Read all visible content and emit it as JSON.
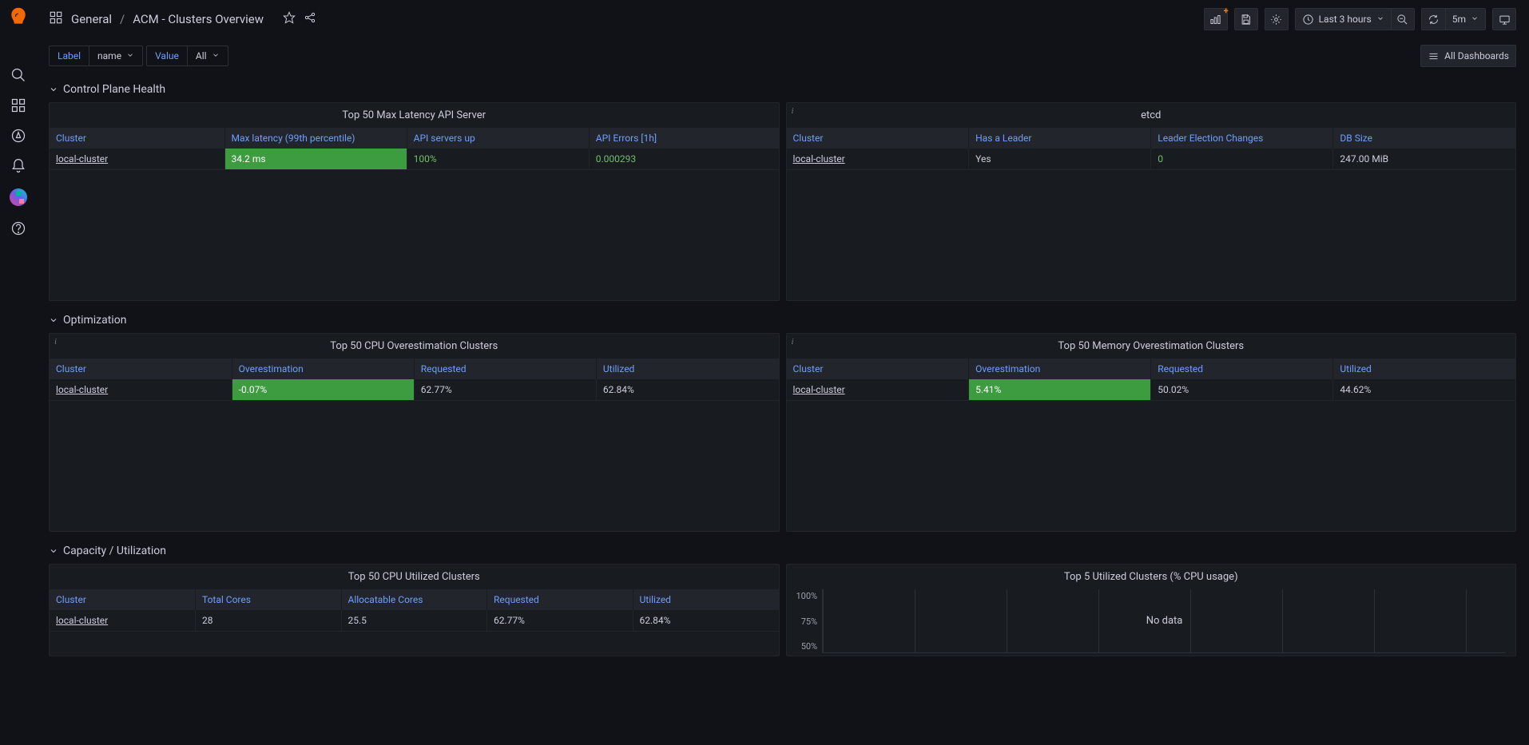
{
  "breadcrumb": {
    "folder": "General",
    "title": "ACM - Clusters Overview"
  },
  "toolbar": {
    "time_range": "Last 3 hours",
    "refresh_interval": "5m",
    "all_dashboards": "All Dashboards"
  },
  "variables": {
    "label_label": "Label",
    "label_value": "name",
    "value_label": "Value",
    "value_value": "All"
  },
  "sections": {
    "control_plane": "Control Plane Health",
    "optimization": "Optimization",
    "capacity": "Capacity / Utilization"
  },
  "panels": {
    "api_server": {
      "title": "Top 50 Max Latency API Server",
      "headers": [
        "Cluster",
        "Max latency (99th percentile)",
        "API servers up",
        "API Errors [1h]"
      ],
      "row": {
        "cluster": "local-cluster",
        "latency": "34.2 ms",
        "servers_up": "100%",
        "errors": "0.000293"
      }
    },
    "etcd": {
      "title": "etcd",
      "headers": [
        "Cluster",
        "Has a Leader",
        "Leader Election Changes",
        "DB Size"
      ],
      "row": {
        "cluster": "local-cluster",
        "leader": "Yes",
        "changes": "0",
        "db_size": "247.00 MiB"
      }
    },
    "cpu_over": {
      "title": "Top 50 CPU Overestimation Clusters",
      "headers": [
        "Cluster",
        "Overestimation",
        "Requested",
        "Utilized"
      ],
      "row": {
        "cluster": "local-cluster",
        "over": "-0.07%",
        "requested": "62.77%",
        "utilized": "62.84%"
      }
    },
    "mem_over": {
      "title": "Top 50 Memory Overestimation Clusters",
      "headers": [
        "Cluster",
        "Overestimation",
        "Requested",
        "Utilized"
      ],
      "row": {
        "cluster": "local-cluster",
        "over": "5.41%",
        "requested": "50.02%",
        "utilized": "44.62%"
      }
    },
    "cpu_util": {
      "title": "Top 50 CPU Utilized Clusters",
      "headers": [
        "Cluster",
        "Total Cores",
        "Allocatable Cores",
        "Requested",
        "Utilized"
      ],
      "row": {
        "cluster": "local-cluster",
        "total": "28",
        "alloc": "25.5",
        "requested": "62.77%",
        "utilized": "62.84%"
      }
    },
    "cpu_chart": {
      "title": "Top 5 Utilized Clusters (% CPU usage)",
      "no_data": "No data",
      "y_ticks": [
        "100%",
        "75%",
        "50%"
      ]
    }
  },
  "chart_data": {
    "type": "line",
    "title": "Top 5 Utilized Clusters (% CPU usage)",
    "ylabel": "",
    "ylim": [
      0,
      100
    ],
    "y_ticks": [
      50,
      75,
      100
    ],
    "series": [],
    "status": "No data"
  }
}
